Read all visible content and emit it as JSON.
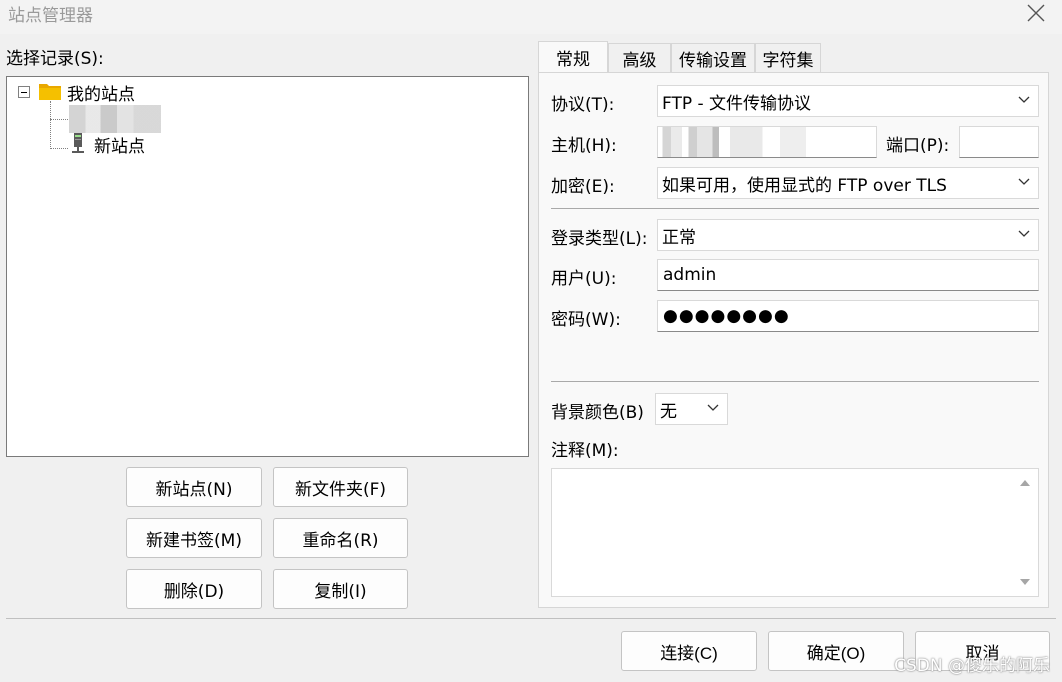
{
  "window": {
    "title": "站点管理器"
  },
  "left": {
    "select_label": "选择记录(S):",
    "tree": {
      "root": "我的站点",
      "new_site": "新站点"
    },
    "buttons": {
      "new_site": "新站点(N)",
      "new_folder": "新文件夹(F)",
      "new_bookmark": "新建书签(M)",
      "rename": "重命名(R)",
      "delete": "删除(D)",
      "copy": "复制(I)"
    }
  },
  "tabs": [
    {
      "label": "常规"
    },
    {
      "label": "高级"
    },
    {
      "label": "传输设置"
    },
    {
      "label": "字符集"
    }
  ],
  "general": {
    "protocol_label": "协议(T):",
    "protocol_value": "FTP - 文件传输协议",
    "host_label": "主机(H):",
    "port_label": "端口(P):",
    "port_value": "",
    "encryption_label": "加密(E):",
    "encryption_value": "如果可用，使用显式的 FTP over TLS",
    "logon_type_label": "登录类型(L):",
    "logon_type_value": "正常",
    "user_label": "用户(U):",
    "user_value": "admin",
    "password_label": "密码(W):",
    "password_value": "●●●●●●●●",
    "bg_color_label": "背景颜色(B)",
    "bg_color_value": "无",
    "comments_label": "注释(M):"
  },
  "footer": {
    "connect": "连接(C)",
    "ok": "确定(O)",
    "cancel": "取消"
  },
  "watermark": "CSDN @傻乐的阿乐",
  "colors": {
    "folder": "#f5b800",
    "background": "#f0f0f0"
  }
}
